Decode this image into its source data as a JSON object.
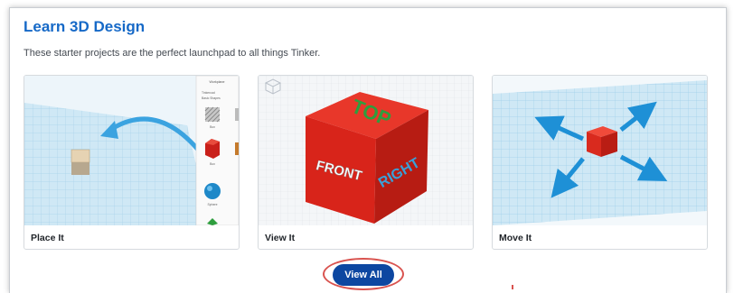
{
  "section": {
    "title": "Learn 3D Design",
    "subtitle": "These starter projects are the perfect launchpad to all things Tinker."
  },
  "cards": [
    {
      "label": "Place It",
      "image": "place-it-thumbnail"
    },
    {
      "label": "View It",
      "image": "view-it-thumbnail",
      "cube_text": {
        "top": "TOP",
        "front": "FRONT",
        "right": "RIGHT"
      }
    },
    {
      "label": "Move It",
      "image": "move-it-thumbnail"
    }
  ],
  "shapes_panel": {
    "heading": "Workplane",
    "category": "Tinkercad",
    "subcategory": "Basic Shapes",
    "items": [
      "Box",
      "Box",
      "Sphere"
    ]
  },
  "view_all_button": {
    "label": "View All"
  },
  "colors": {
    "title_blue": "#1669c7",
    "button_blue": "#0d47a1",
    "highlight_red": "#d9534f",
    "grid_blue": "#bfe0f2",
    "cube_red": "#e1261c",
    "arrow_blue": "#1e90d6"
  }
}
